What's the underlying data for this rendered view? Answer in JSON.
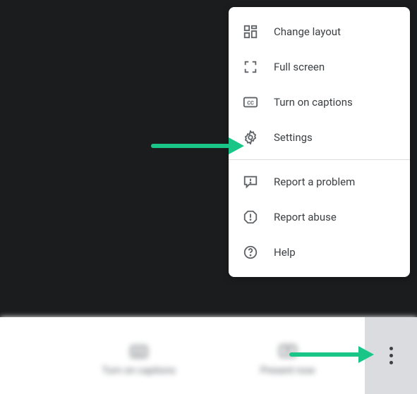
{
  "menu": {
    "items": [
      {
        "label": "Change layout"
      },
      {
        "label": "Full screen"
      },
      {
        "label": "Turn on captions"
      },
      {
        "label": "Settings"
      },
      {
        "label": "Report a problem"
      },
      {
        "label": "Report abuse"
      },
      {
        "label": "Help"
      }
    ]
  },
  "bottom_bar": {
    "captions_label": "Turn on captions",
    "present_label": "Present now"
  }
}
